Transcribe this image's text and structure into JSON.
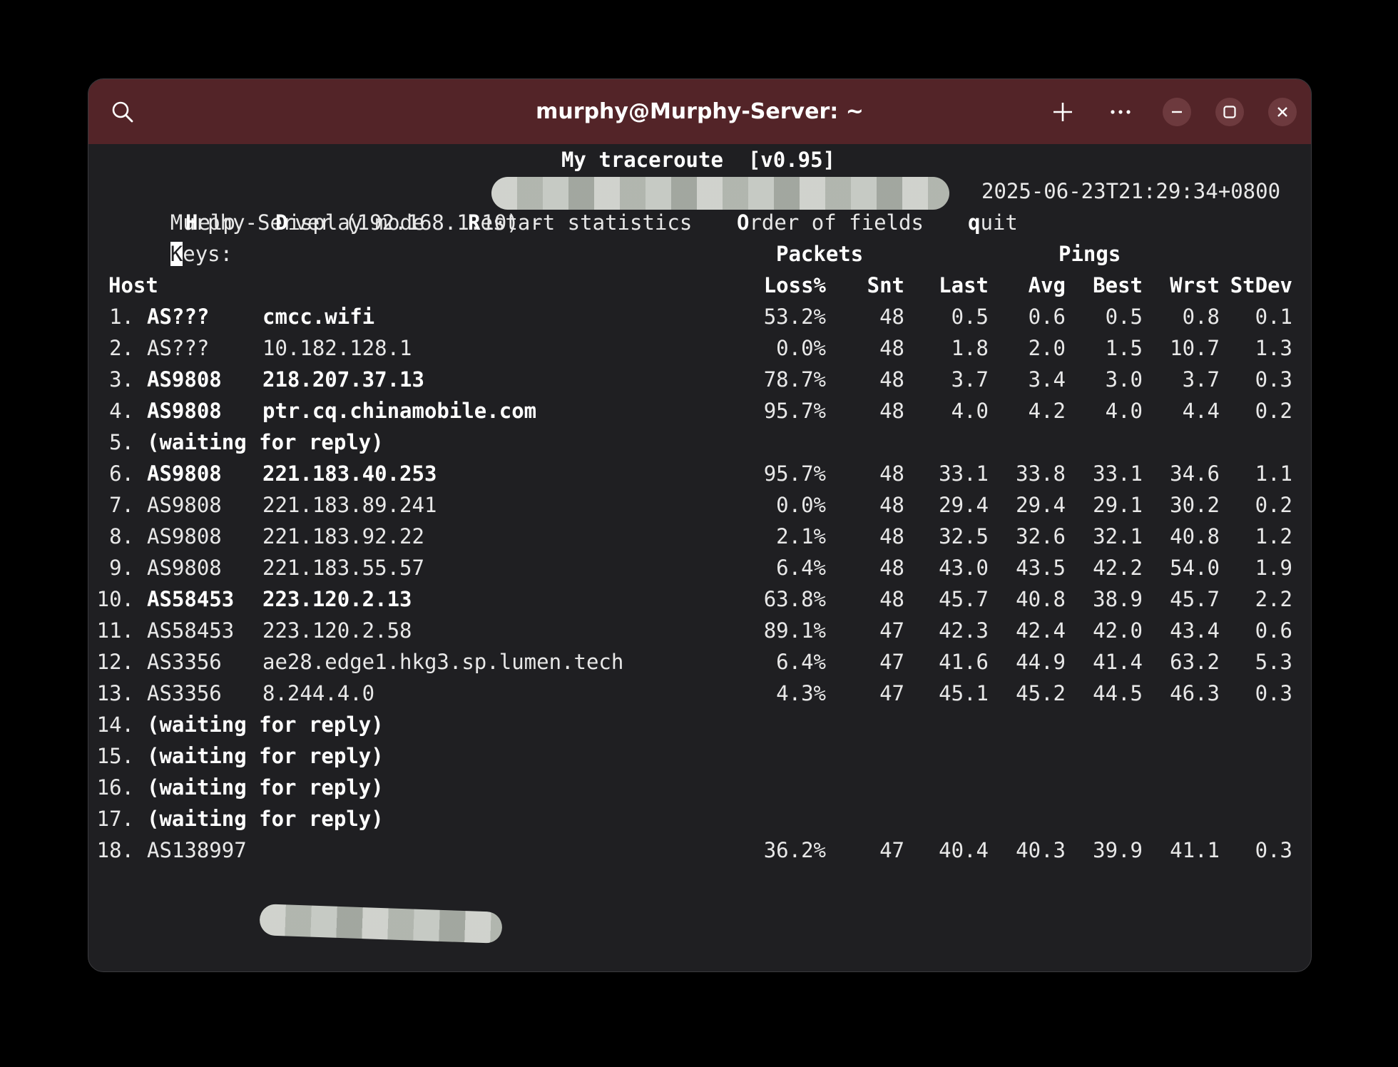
{
  "window": {
    "title": "murphy@Murphy-Server: ~",
    "icons": {
      "search": "search-icon",
      "new_tab": "plus-icon",
      "menu": "more-icon",
      "minimize": "minimize-icon",
      "maximize": "maximize-icon",
      "close": "close-icon"
    }
  },
  "mtr": {
    "header": "My traceroute  [v0.95]",
    "host_line": "Murphy-Server (192.168.1.10) -",
    "timestamp": "2025-06-23T21:29:34+0800",
    "keys_label": "eys:",
    "keys_first": "K",
    "keys": [
      {
        "key": "H",
        "rest": "elp"
      },
      {
        "key": "D",
        "rest": "isplay mode"
      },
      {
        "key": "R",
        "rest": "estart statistics"
      },
      {
        "key": "O",
        "rest": "rder of fields"
      },
      {
        "key": "q",
        "rest": "uit"
      }
    ],
    "group_packets": "Packets",
    "group_pings": "Pings",
    "columns": {
      "host": "Host",
      "loss": "Loss%",
      "snt": "Snt",
      "last": "Last",
      "avg": "Avg",
      "best": "Best",
      "wrst": "Wrst",
      "stdev": "StDev"
    },
    "rows": [
      {
        "num": "1.",
        "as": "AS???",
        "host": "cmcc.wifi",
        "loss": "53.2%",
        "snt": "48",
        "last": "0.5",
        "avg": "0.6",
        "best": "0.5",
        "wrst": "0.8",
        "stdev": "0.1",
        "bold": true
      },
      {
        "num": "2.",
        "as": "AS???",
        "host": "10.182.128.1",
        "loss": "0.0%",
        "snt": "48",
        "last": "1.8",
        "avg": "2.0",
        "best": "1.5",
        "wrst": "10.7",
        "stdev": "1.3",
        "bold": false
      },
      {
        "num": "3.",
        "as": "AS9808",
        "host": "218.207.37.13",
        "loss": "78.7%",
        "snt": "48",
        "last": "3.7",
        "avg": "3.4",
        "best": "3.0",
        "wrst": "3.7",
        "stdev": "0.3",
        "bold": true
      },
      {
        "num": "4.",
        "as": "AS9808",
        "host": "ptr.cq.chinamobile.com",
        "loss": "95.7%",
        "snt": "48",
        "last": "4.0",
        "avg": "4.2",
        "best": "4.0",
        "wrst": "4.4",
        "stdev": "0.2",
        "bold": true
      },
      {
        "num": "5.",
        "waiting": "(waiting for reply)"
      },
      {
        "num": "6.",
        "as": "AS9808",
        "host": "221.183.40.253",
        "loss": "95.7%",
        "snt": "48",
        "last": "33.1",
        "avg": "33.8",
        "best": "33.1",
        "wrst": "34.6",
        "stdev": "1.1",
        "bold": true
      },
      {
        "num": "7.",
        "as": "AS9808",
        "host": "221.183.89.241",
        "loss": "0.0%",
        "snt": "48",
        "last": "29.4",
        "avg": "29.4",
        "best": "29.1",
        "wrst": "30.2",
        "stdev": "0.2",
        "bold": false
      },
      {
        "num": "8.",
        "as": "AS9808",
        "host": "221.183.92.22",
        "loss": "2.1%",
        "snt": "48",
        "last": "32.5",
        "avg": "32.6",
        "best": "32.1",
        "wrst": "40.8",
        "stdev": "1.2",
        "bold": false
      },
      {
        "num": "9.",
        "as": "AS9808",
        "host": "221.183.55.57",
        "loss": "6.4%",
        "snt": "48",
        "last": "43.0",
        "avg": "43.5",
        "best": "42.2",
        "wrst": "54.0",
        "stdev": "1.9",
        "bold": false
      },
      {
        "num": "10.",
        "as": "AS58453",
        "host": "223.120.2.13",
        "loss": "63.8%",
        "snt": "48",
        "last": "45.7",
        "avg": "40.8",
        "best": "38.9",
        "wrst": "45.7",
        "stdev": "2.2",
        "bold": true
      },
      {
        "num": "11.",
        "as": "AS58453",
        "host": "223.120.2.58",
        "loss": "89.1%",
        "snt": "47",
        "last": "42.3",
        "avg": "42.4",
        "best": "42.0",
        "wrst": "43.4",
        "stdev": "0.6",
        "bold": false
      },
      {
        "num": "12.",
        "as": "AS3356",
        "host": "ae28.edge1.hkg3.sp.lumen.tech",
        "loss": "6.4%",
        "snt": "47",
        "last": "41.6",
        "avg": "44.9",
        "best": "41.4",
        "wrst": "63.2",
        "stdev": "5.3",
        "bold": false
      },
      {
        "num": "13.",
        "as": "AS3356",
        "host": "8.244.4.0",
        "loss": "4.3%",
        "snt": "47",
        "last": "45.1",
        "avg": "45.2",
        "best": "44.5",
        "wrst": "46.3",
        "stdev": "0.3",
        "bold": false
      },
      {
        "num": "14.",
        "waiting": "(waiting for reply)"
      },
      {
        "num": "15.",
        "waiting": "(waiting for reply)"
      },
      {
        "num": "16.",
        "waiting": "(waiting for reply)"
      },
      {
        "num": "17.",
        "waiting": "(waiting for reply)"
      },
      {
        "num": "18.",
        "as": "AS138997",
        "host": "",
        "loss": "36.2%",
        "snt": "47",
        "last": "40.4",
        "avg": "40.3",
        "best": "39.9",
        "wrst": "41.1",
        "stdev": "0.3",
        "bold": false
      }
    ]
  }
}
